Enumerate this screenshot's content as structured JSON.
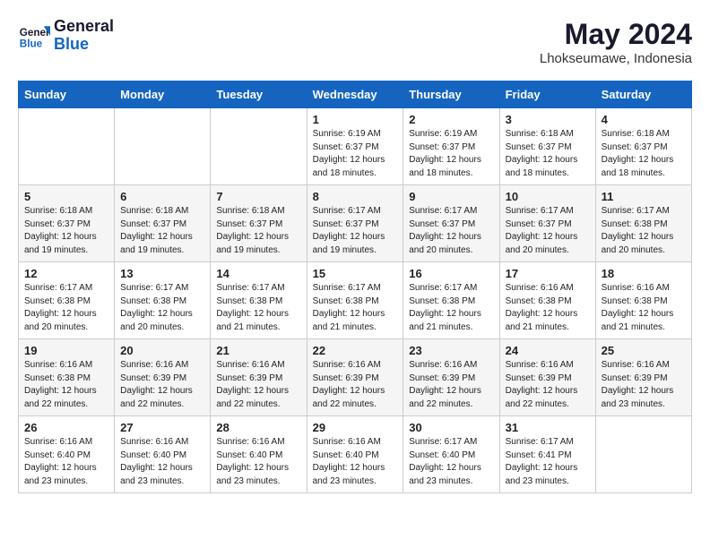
{
  "header": {
    "logo_line1": "General",
    "logo_line2": "Blue",
    "month_year": "May 2024",
    "location": "Lhokseumawe, Indonesia"
  },
  "days_of_week": [
    "Sunday",
    "Monday",
    "Tuesday",
    "Wednesday",
    "Thursday",
    "Friday",
    "Saturday"
  ],
  "weeks": [
    [
      {
        "day": "",
        "info": ""
      },
      {
        "day": "",
        "info": ""
      },
      {
        "day": "",
        "info": ""
      },
      {
        "day": "1",
        "info": "Sunrise: 6:19 AM\nSunset: 6:37 PM\nDaylight: 12 hours\nand 18 minutes."
      },
      {
        "day": "2",
        "info": "Sunrise: 6:19 AM\nSunset: 6:37 PM\nDaylight: 12 hours\nand 18 minutes."
      },
      {
        "day": "3",
        "info": "Sunrise: 6:18 AM\nSunset: 6:37 PM\nDaylight: 12 hours\nand 18 minutes."
      },
      {
        "day": "4",
        "info": "Sunrise: 6:18 AM\nSunset: 6:37 PM\nDaylight: 12 hours\nand 18 minutes."
      }
    ],
    [
      {
        "day": "5",
        "info": "Sunrise: 6:18 AM\nSunset: 6:37 PM\nDaylight: 12 hours\nand 19 minutes."
      },
      {
        "day": "6",
        "info": "Sunrise: 6:18 AM\nSunset: 6:37 PM\nDaylight: 12 hours\nand 19 minutes."
      },
      {
        "day": "7",
        "info": "Sunrise: 6:18 AM\nSunset: 6:37 PM\nDaylight: 12 hours\nand 19 minutes."
      },
      {
        "day": "8",
        "info": "Sunrise: 6:17 AM\nSunset: 6:37 PM\nDaylight: 12 hours\nand 19 minutes."
      },
      {
        "day": "9",
        "info": "Sunrise: 6:17 AM\nSunset: 6:37 PM\nDaylight: 12 hours\nand 20 minutes."
      },
      {
        "day": "10",
        "info": "Sunrise: 6:17 AM\nSunset: 6:37 PM\nDaylight: 12 hours\nand 20 minutes."
      },
      {
        "day": "11",
        "info": "Sunrise: 6:17 AM\nSunset: 6:38 PM\nDaylight: 12 hours\nand 20 minutes."
      }
    ],
    [
      {
        "day": "12",
        "info": "Sunrise: 6:17 AM\nSunset: 6:38 PM\nDaylight: 12 hours\nand 20 minutes."
      },
      {
        "day": "13",
        "info": "Sunrise: 6:17 AM\nSunset: 6:38 PM\nDaylight: 12 hours\nand 20 minutes."
      },
      {
        "day": "14",
        "info": "Sunrise: 6:17 AM\nSunset: 6:38 PM\nDaylight: 12 hours\nand 21 minutes."
      },
      {
        "day": "15",
        "info": "Sunrise: 6:17 AM\nSunset: 6:38 PM\nDaylight: 12 hours\nand 21 minutes."
      },
      {
        "day": "16",
        "info": "Sunrise: 6:17 AM\nSunset: 6:38 PM\nDaylight: 12 hours\nand 21 minutes."
      },
      {
        "day": "17",
        "info": "Sunrise: 6:16 AM\nSunset: 6:38 PM\nDaylight: 12 hours\nand 21 minutes."
      },
      {
        "day": "18",
        "info": "Sunrise: 6:16 AM\nSunset: 6:38 PM\nDaylight: 12 hours\nand 21 minutes."
      }
    ],
    [
      {
        "day": "19",
        "info": "Sunrise: 6:16 AM\nSunset: 6:38 PM\nDaylight: 12 hours\nand 22 minutes."
      },
      {
        "day": "20",
        "info": "Sunrise: 6:16 AM\nSunset: 6:39 PM\nDaylight: 12 hours\nand 22 minutes."
      },
      {
        "day": "21",
        "info": "Sunrise: 6:16 AM\nSunset: 6:39 PM\nDaylight: 12 hours\nand 22 minutes."
      },
      {
        "day": "22",
        "info": "Sunrise: 6:16 AM\nSunset: 6:39 PM\nDaylight: 12 hours\nand 22 minutes."
      },
      {
        "day": "23",
        "info": "Sunrise: 6:16 AM\nSunset: 6:39 PM\nDaylight: 12 hours\nand 22 minutes."
      },
      {
        "day": "24",
        "info": "Sunrise: 6:16 AM\nSunset: 6:39 PM\nDaylight: 12 hours\nand 22 minutes."
      },
      {
        "day": "25",
        "info": "Sunrise: 6:16 AM\nSunset: 6:39 PM\nDaylight: 12 hours\nand 23 minutes."
      }
    ],
    [
      {
        "day": "26",
        "info": "Sunrise: 6:16 AM\nSunset: 6:40 PM\nDaylight: 12 hours\nand 23 minutes."
      },
      {
        "day": "27",
        "info": "Sunrise: 6:16 AM\nSunset: 6:40 PM\nDaylight: 12 hours\nand 23 minutes."
      },
      {
        "day": "28",
        "info": "Sunrise: 6:16 AM\nSunset: 6:40 PM\nDaylight: 12 hours\nand 23 minutes."
      },
      {
        "day": "29",
        "info": "Sunrise: 6:16 AM\nSunset: 6:40 PM\nDaylight: 12 hours\nand 23 minutes."
      },
      {
        "day": "30",
        "info": "Sunrise: 6:17 AM\nSunset: 6:40 PM\nDaylight: 12 hours\nand 23 minutes."
      },
      {
        "day": "31",
        "info": "Sunrise: 6:17 AM\nSunset: 6:41 PM\nDaylight: 12 hours\nand 23 minutes."
      },
      {
        "day": "",
        "info": ""
      }
    ]
  ]
}
